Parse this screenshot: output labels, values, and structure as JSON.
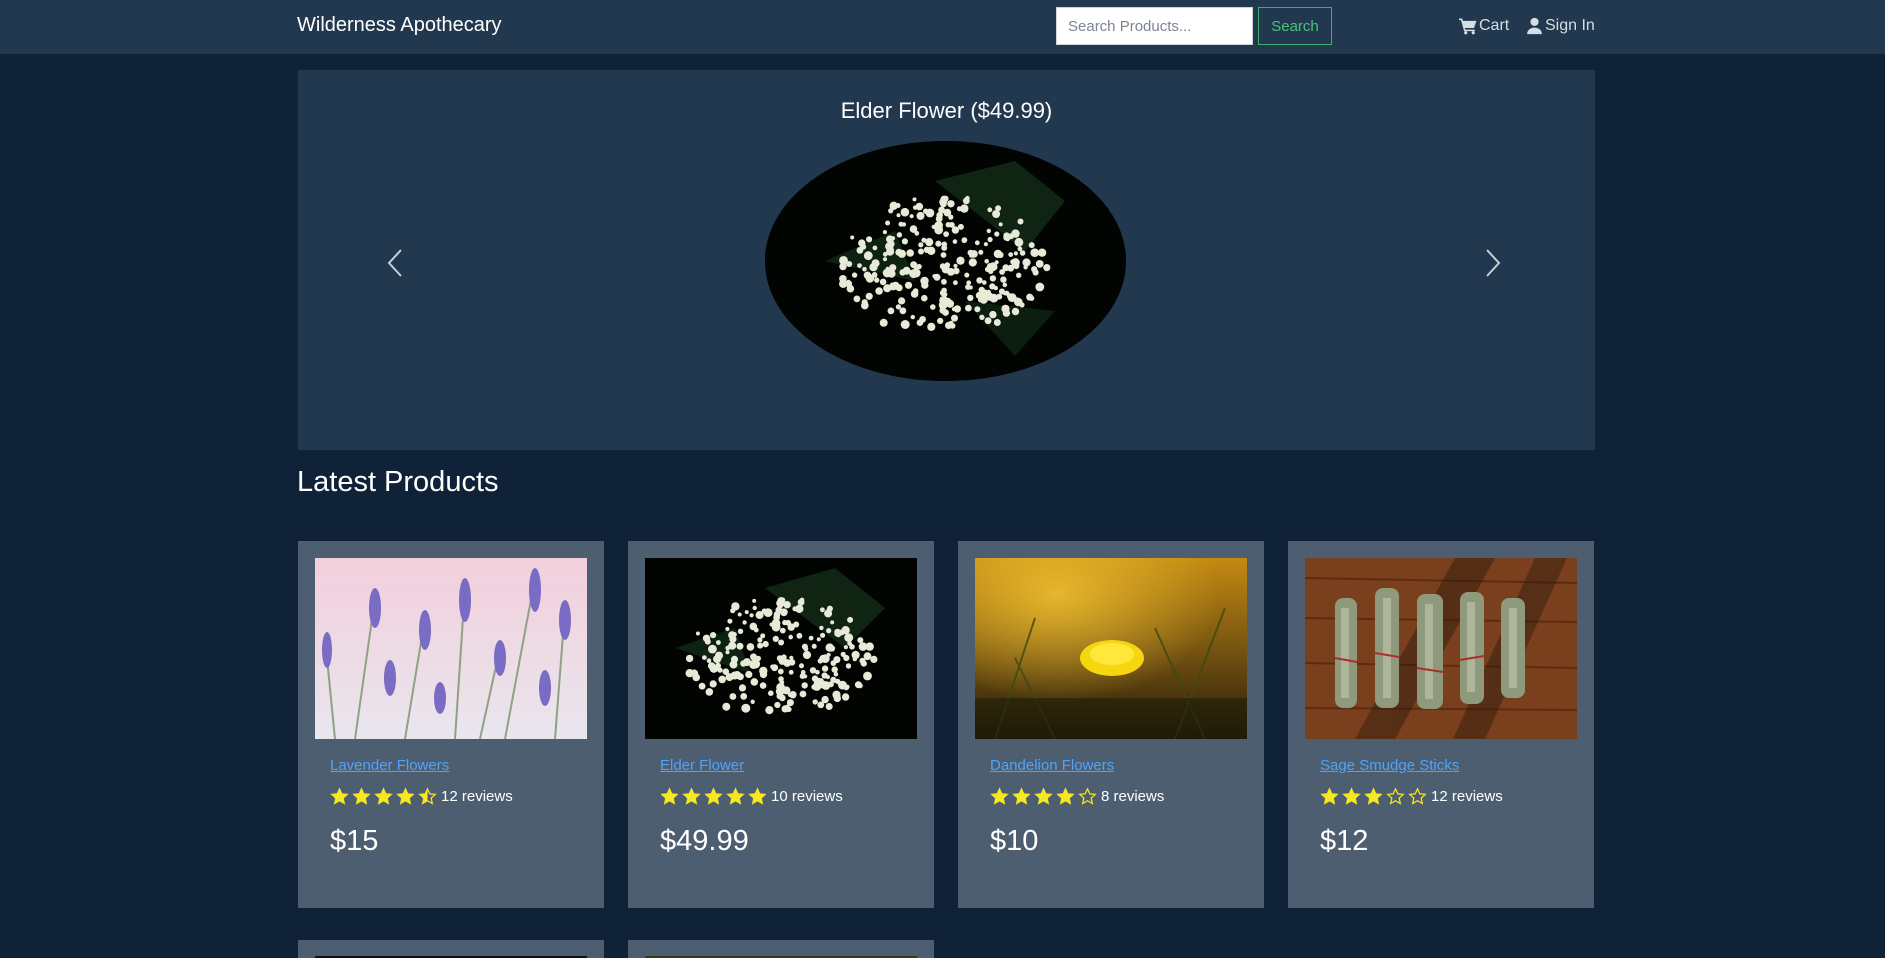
{
  "navbar": {
    "brand": "Wilderness Apothecary",
    "search_placeholder": "Search Products...",
    "search_button": "Search",
    "cart_label": "Cart",
    "signin_label": "Sign In"
  },
  "carousel": {
    "caption": "Elder Flower ($49.99)"
  },
  "latest": {
    "title": "Latest Products",
    "products": [
      {
        "name": "Lavender Flowers",
        "rating": 4.5,
        "reviews": "12 reviews",
        "price": "$15",
        "image": "lavender"
      },
      {
        "name": "Elder Flower",
        "rating": 5,
        "reviews": "10 reviews",
        "price": "$49.99",
        "image": "elderflower"
      },
      {
        "name": "Dandelion Flowers",
        "rating": 4,
        "reviews": "8 reviews",
        "price": "$10",
        "image": "dandelion"
      },
      {
        "name": "Sage Smudge Sticks",
        "rating": 3,
        "reviews": "12 reviews",
        "price": "$12",
        "image": "sage"
      }
    ]
  },
  "colors": {
    "page_bg": "#0f2237",
    "navbar_bg": "#22384f",
    "card_bg": "#4d5e70",
    "link": "#4ea3ff",
    "star": "#f8e71c",
    "search_btn": "#4cc17b"
  }
}
